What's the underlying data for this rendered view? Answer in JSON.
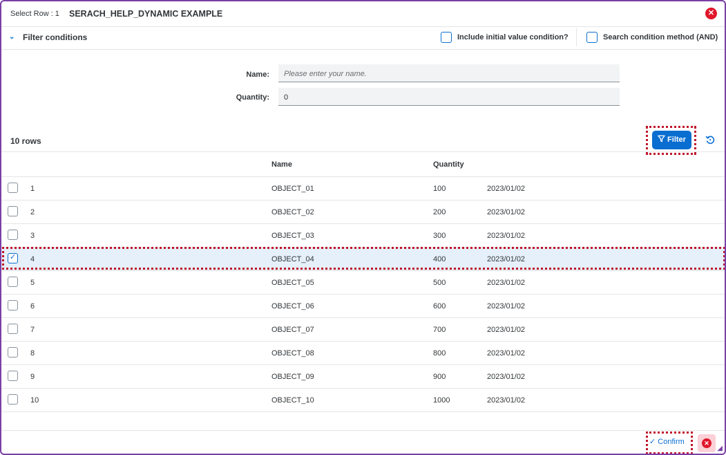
{
  "header": {
    "select_row_label": "Select Row : 1",
    "title": "SERACH_HELP_DYNAMIC EXAMPLE",
    "close_glyph": "✕"
  },
  "filter_bar": {
    "chevron_glyph": "⌄",
    "title": "Filter conditions",
    "include_initial": "Include initial value condition?",
    "search_method": "Search condition method (AND)"
  },
  "form": {
    "name_label": "Name:",
    "name_placeholder": "Please enter your name.",
    "quantity_label": "Quantity:",
    "quantity_value": "0"
  },
  "toolbar": {
    "rows_count": "10 rows",
    "filter_label": "Filter",
    "filter_icon": "filter-icon",
    "reset_icon": "reset-icon"
  },
  "table": {
    "columns": [
      "Name",
      "Quantity"
    ],
    "rows": [
      {
        "num": "1",
        "name": "OBJECT_01",
        "qty": "100",
        "date": "2023/01/02",
        "selected": false
      },
      {
        "num": "2",
        "name": "OBJECT_02",
        "qty": "200",
        "date": "2023/01/02",
        "selected": false
      },
      {
        "num": "3",
        "name": "OBJECT_03",
        "qty": "300",
        "date": "2023/01/02",
        "selected": false
      },
      {
        "num": "4",
        "name": "OBJECT_04",
        "qty": "400",
        "date": "2023/01/02",
        "selected": true
      },
      {
        "num": "5",
        "name": "OBJECT_05",
        "qty": "500",
        "date": "2023/01/02",
        "selected": false
      },
      {
        "num": "6",
        "name": "OBJECT_06",
        "qty": "600",
        "date": "2023/01/02",
        "selected": false
      },
      {
        "num": "7",
        "name": "OBJECT_07",
        "qty": "700",
        "date": "2023/01/02",
        "selected": false
      },
      {
        "num": "8",
        "name": "OBJECT_08",
        "qty": "800",
        "date": "2023/01/02",
        "selected": false
      },
      {
        "num": "9",
        "name": "OBJECT_09",
        "qty": "900",
        "date": "2023/01/02",
        "selected": false
      },
      {
        "num": "10",
        "name": "OBJECT_10",
        "qty": "1000",
        "date": "2023/01/02",
        "selected": false
      }
    ]
  },
  "footer": {
    "confirm_label": "✓  Confirm",
    "close_glyph": "✕"
  },
  "colors": {
    "accent": "#0a6ed1",
    "frame": "#7a3fa6",
    "highlight": "#c0142b",
    "selected_row": "#e5f0fa"
  }
}
